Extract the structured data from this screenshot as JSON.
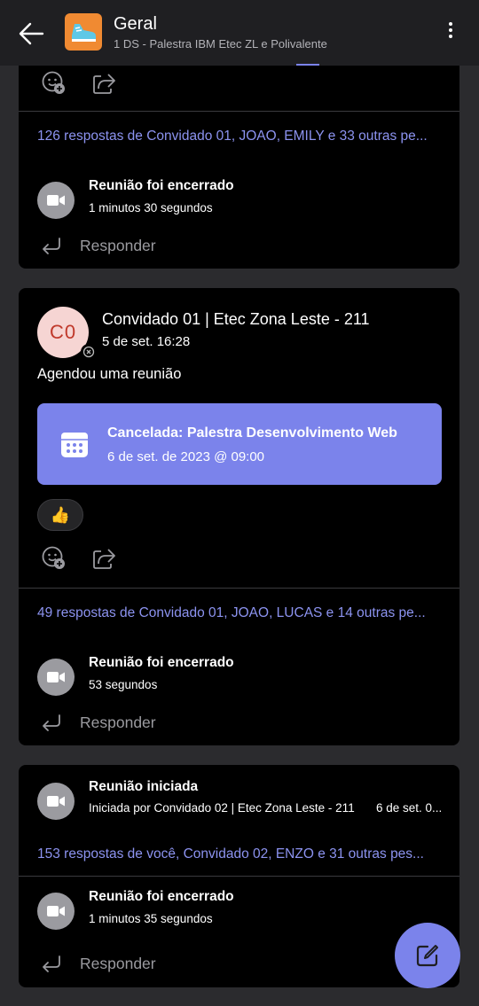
{
  "header": {
    "title": "Geral",
    "subtitle": "1 DS - Palestra IBM Etec ZL e Polivalente"
  },
  "card1": {
    "replies": "126 respostas de Convidado 01, JOAO, EMILY e 33 outras pe...",
    "event_title": "Reunião foi encerrado",
    "event_duration": "1 minutos 30 segundos",
    "reply_label": "Responder"
  },
  "card2": {
    "avatar_initials": "C0",
    "author": "Convidado 01 | Etec Zona Leste - 211",
    "time": "5 de set. 16:28",
    "text": "Agendou uma reunião",
    "meeting_title": "Cancelada: Palestra Desenvolvimento Web",
    "meeting_date": "6 de set. de 2023 @ 09:00",
    "reaction_emoji": "👍",
    "replies": "49 respostas de Convidado 01, JOAO, LUCAS e 14 outras pe...",
    "event_title": "Reunião foi encerrado",
    "event_duration": "53 segundos",
    "reply_label": "Responder"
  },
  "card3": {
    "started_title": "Reunião iniciada",
    "started_by": "Iniciada por Convidado 02 | Etec Zona Leste - 211",
    "started_time": "6 de set. 0...",
    "replies": "153 respostas de você, Convidado 02, ENZO e 31 outras pes...",
    "event_title": "Reunião foi encerrado",
    "event_duration": "1 minutos 35 segundos",
    "reply_label": "Responder"
  },
  "colors": {
    "accent": "#7b83eb",
    "card_bg": "#000000",
    "page_bg": "#2b2b2e"
  }
}
